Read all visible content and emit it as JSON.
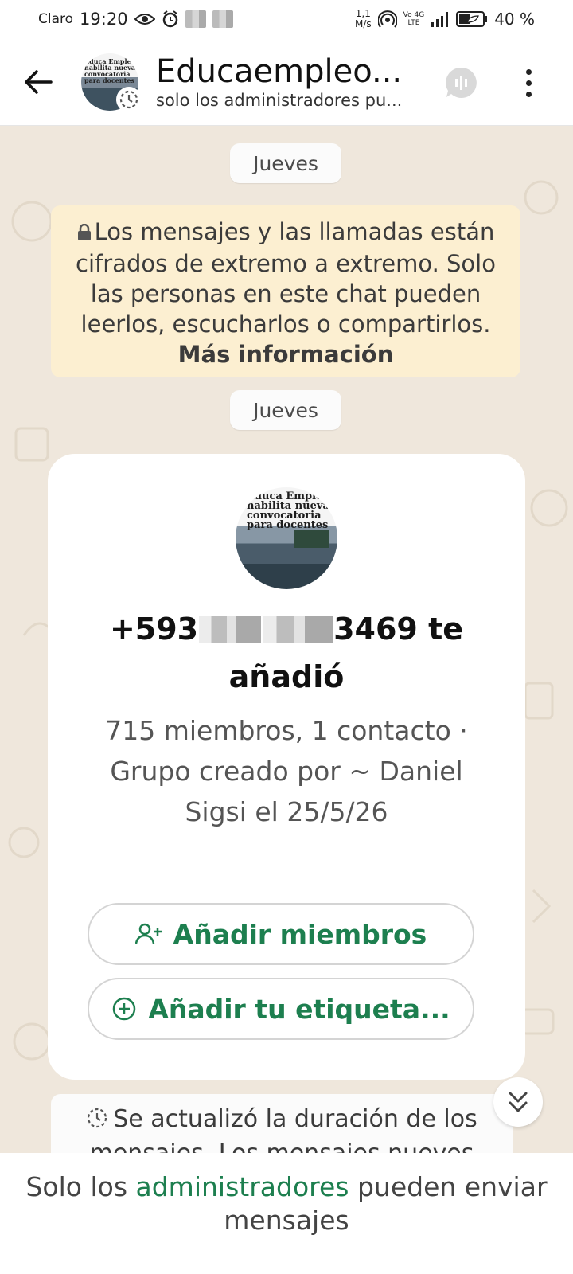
{
  "status_bar": {
    "carrier": "Claro",
    "time": "19:20",
    "net_speed_value": "1,1",
    "net_speed_unit": "M/s",
    "network_top": "Vo 4G",
    "network_bottom": "LTE",
    "battery": "40 %"
  },
  "header": {
    "title": "Educaempleo...",
    "subtitle": "solo los administradores pu...",
    "avatar_text": "Educa Empleo habilita nueva convocatoria para docentes"
  },
  "chat": {
    "date_label_1": "Jueves",
    "encryption_text": "Los mensajes y las llamadas están cifrados de extremo a extremo. Solo las personas en este chat pueden leerlos, escucharlos o compartirlos.",
    "encryption_link": "Más información",
    "date_label_2": "Jueves",
    "system_card": {
      "avatar_text": "Educa Empleo habilita nueva convocatoria para docentes",
      "added_prefix": "+593",
      "added_suffix": "3469 te añadió",
      "group_info": "715 miembros, 1 contacto · Grupo creado por ~ Daniel Sigsi el 25/5/26",
      "add_members_label": "Añadir miembros",
      "add_tag_label": "Añadir tu etiqueta..."
    },
    "update_notice": "Se actualizó la duración de los mensajes. Los mensajes nuevos"
  },
  "footer": {
    "prefix": "Solo los",
    "link": "administradores",
    "suffix": "pueden enviar mensajes"
  },
  "colors": {
    "accent_green": "#1d7f4f",
    "chat_background": "#efe7dc",
    "encryption_background": "#fcefd1"
  }
}
